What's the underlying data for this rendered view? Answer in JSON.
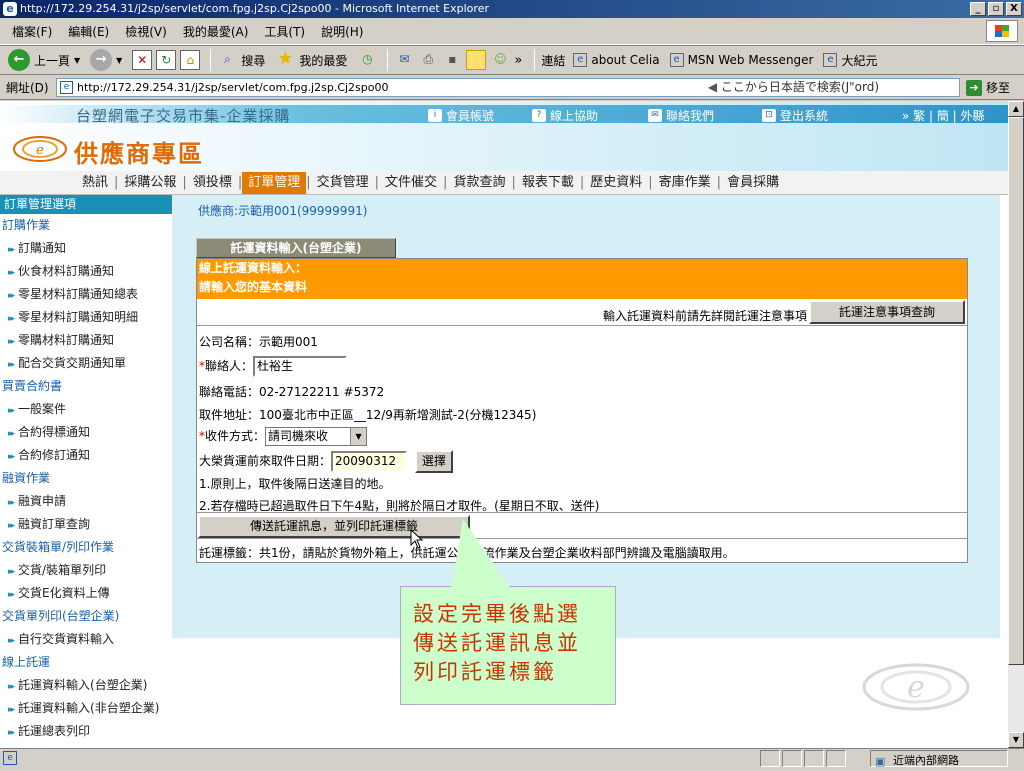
{
  "window": {
    "title": "http://172.29.254.31/j2sp/servlet/com.fpg.j2sp.Cj2spo00 - Microsoft Internet Explorer",
    "controls": [
      "_",
      "▫",
      "X"
    ]
  },
  "menu": [
    "檔案(F)",
    "編輯(E)",
    "檢視(V)",
    "我的最愛(A)",
    "工具(T)",
    "說明(H)"
  ],
  "toolbar": {
    "back": "上一頁",
    "search": "搜尋",
    "favorites": "我的最愛",
    "links_label": "連結",
    "links": [
      "about Celia",
      "MSN Web Messenger",
      "大紀元"
    ],
    "more": "»"
  },
  "address": {
    "label": "網址(D)",
    "url": "http://172.29.254.31/j2sp/servlet/com.fpg.j2sp.Cj2spo00",
    "search_hint": "ここから日本語で検索(J\"ord)",
    "go": "移至"
  },
  "banner": {
    "site_title": "台塑網電子交易市集-企業採購",
    "zone": "供應商專區",
    "nav": [
      "會員帳號",
      "線上協助",
      "聯絡我們",
      "登出系統"
    ],
    "nav_icons": [
      "i",
      "?",
      "✉",
      "⊡"
    ],
    "lang": "» 繁 | 簡 | 外縣"
  },
  "mainnav": {
    "items": [
      "熱訊",
      "採購公報",
      "領投標",
      "訂單管理",
      "交貨管理",
      "文件催交",
      "貨款查詢",
      "報表下載",
      "歷史資料",
      "寄庫作業",
      "會員採購"
    ],
    "active_index": 3
  },
  "sidebar": {
    "title": "訂單管理選項",
    "groups": [
      {
        "category": "訂購作業",
        "items": [
          "訂購通知",
          "伙食材料訂購通知",
          "零星材料訂購通知總表",
          "零星材料訂購通知明細",
          "零購材料訂購通知",
          "配合交貨交期通知單"
        ]
      },
      {
        "category": "買賣合約書",
        "items": [
          "一般案件",
          "合約得標通知",
          "合約修訂通知"
        ]
      },
      {
        "category": "融資作業",
        "items": [
          "融資申請",
          "融資訂單查詢"
        ]
      },
      {
        "category": "交貨裝箱單/列印作業",
        "items": [
          "交貨/裝箱單列印",
          "交貨E化資料上傳"
        ]
      },
      {
        "category": "交貨單列印(台塑企業)",
        "items": [
          "自行交貨資料輸入"
        ]
      },
      {
        "category": "線上託運",
        "items": [
          "託運資料輸入(台塑企業)",
          "託運資料輸入(非台塑企業)",
          "託運總表列印"
        ]
      }
    ]
  },
  "content": {
    "supplier": "供應商:示範用001(99999991)",
    "form_tab": "託運資料輸入(台塑企業)",
    "band_line1": "線上託運資料輸入：",
    "band_line2": "請輸入您的基本資料",
    "notice_text": "輸入託運資料前請先詳閱託運注意事項",
    "notice_button": "託運注意事項查詢",
    "company_label": "公司名稱：",
    "company_value": "示範用001",
    "contact_label": "聯絡人：",
    "contact_value": "杜裕生",
    "phone_label": "聯絡電話：",
    "phone_value": "02-27122211 #5372",
    "pickup_label": "取件地址：",
    "pickup_value": "100臺北市中正區__12/9再新增測試-2(分機12345)",
    "method_label": "收件方式：",
    "method_value": "請司機來收",
    "date_label": "大榮貨運前來取件日期：",
    "date_value": "20090312",
    "date_button": "選擇",
    "note1": "1.原則上，取件後隔日送達目的地。",
    "note2": "2.若存檔時已超過取件日下午4點，則將於隔日才取件。(星期日不取、送件)",
    "submit_button": "傳送託運訊息，並列印託運標籤",
    "label_note": "託運標籤：共1份，請貼於貨物外箱上，供託運公司物流作業及台塑企業收料部門辨識及電腦讀取用。"
  },
  "callout": {
    "lines": [
      "設定完畢後點選",
      "傳送託運訊息並",
      "列印託運標籤"
    ]
  },
  "statusbar": {
    "zone": "近端內部網路"
  },
  "colors": {
    "accent_orange": "#ff9900",
    "nav_blue": "#1a8fb8",
    "content_bg": "#d6eef5",
    "callout_bg": "#ccffcc",
    "callout_text": "#cc3300"
  }
}
